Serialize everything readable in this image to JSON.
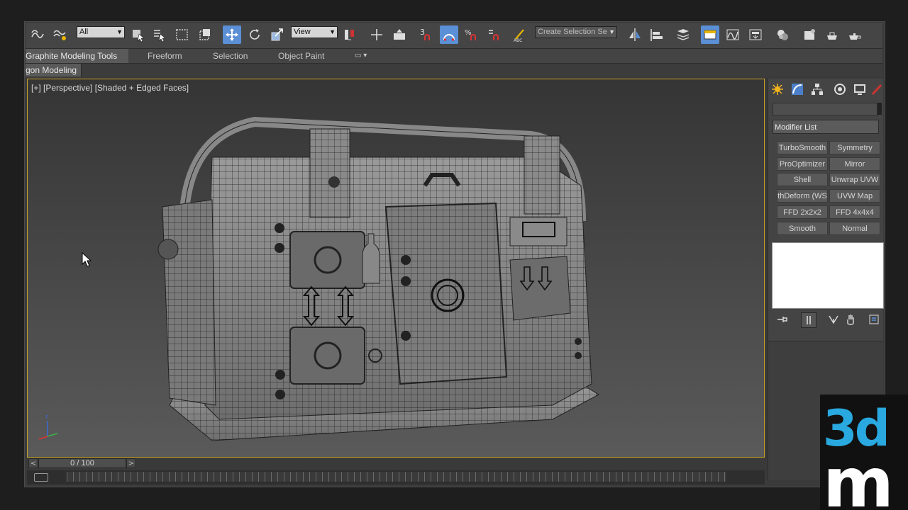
{
  "toolbar": {
    "selection_filter": "All",
    "ref_coord": "View",
    "snap_label": "3",
    "selection_set_placeholder": "Create Selection Se"
  },
  "ribbon": {
    "tabs": [
      "Graphite Modeling Tools",
      "Freeform",
      "Selection",
      "Object Paint"
    ],
    "subtab": "gon Modeling"
  },
  "viewport": {
    "label": "[+] [Perspective] [Shaded + Edged Faces]"
  },
  "panel": {
    "modifier_list": "Modifier List",
    "modifiers": [
      "TurboSmooth",
      "Symmetry",
      "ProOptimizer",
      "Mirror",
      "Shell",
      "Unwrap UVW",
      "thDeform (WS",
      "UVW Map",
      "FFD 2x2x2",
      "FFD 4x4x4",
      "Smooth",
      "Normal"
    ]
  },
  "timeline": {
    "frame": "0 / 100"
  },
  "colors": {
    "viewport_border": "#c9a227",
    "active_button": "#5b8fd6",
    "logo_blue": "#29a9e0"
  }
}
